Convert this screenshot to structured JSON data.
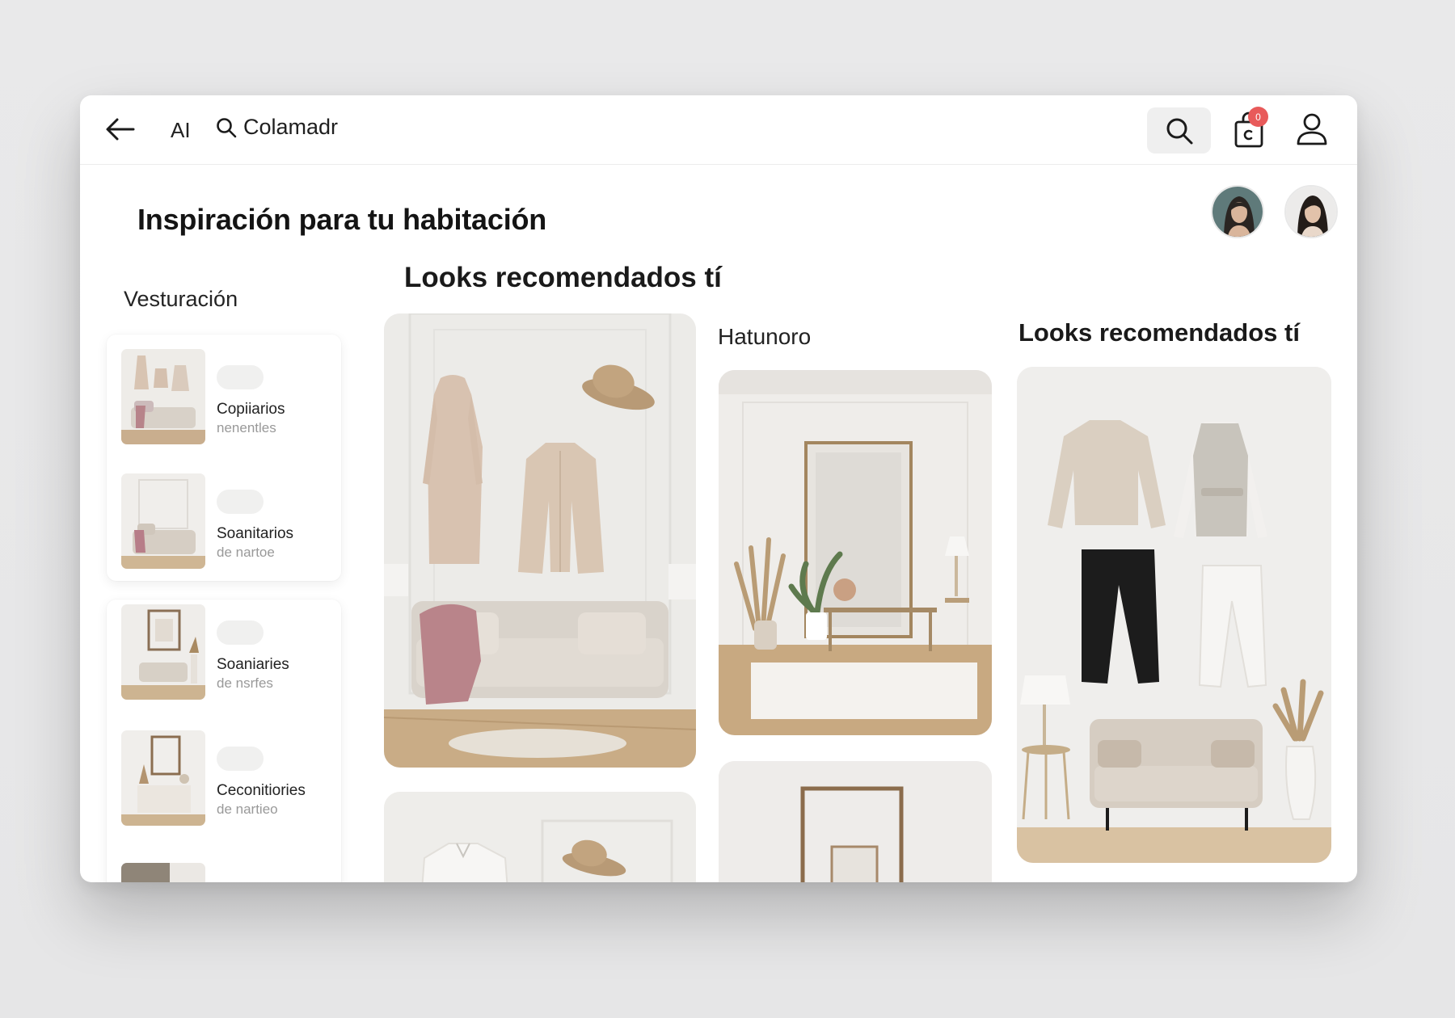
{
  "topbar": {
    "ai_label": "AI",
    "search_text": "Colamadr",
    "cart_badge": "0"
  },
  "page_title": "Inspiración para tu habitación",
  "sidebar": {
    "title": "Vesturación",
    "items": [
      {
        "title": "Copiiarios",
        "subtitle": "nenentles"
      },
      {
        "title": "Soanitarios",
        "subtitle": "de nartoe"
      },
      {
        "title": "Soaniaries",
        "subtitle": "de nsrfes"
      },
      {
        "title": "Ceconitiories",
        "subtitle": "de nartieo"
      }
    ]
  },
  "sections": {
    "looks_title": "Looks recomendados tí",
    "middle_title": "Hatunoro",
    "right_title": "Looks recomendados tí"
  },
  "colors": {
    "accent_badge": "#e85a5a",
    "search_bg": "#efefef"
  },
  "icons": [
    "arrow-left-icon",
    "search-icon",
    "shopping-bag-icon",
    "user-icon"
  ]
}
